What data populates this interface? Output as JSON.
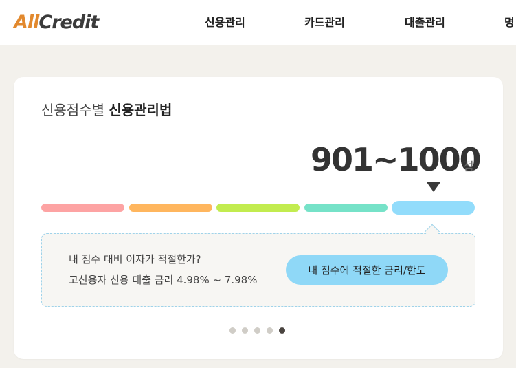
{
  "header": {
    "logo_part1": "All",
    "logo_part2": "Credit",
    "nav": [
      {
        "label": "신용관리"
      },
      {
        "label": "카드관리"
      },
      {
        "label": "대출관리"
      },
      {
        "label": "명"
      }
    ]
  },
  "card": {
    "title_regular": "신용점수별",
    "title_bold": "신용관리법",
    "score_range": "901~1000",
    "score_unit": "점",
    "grade_bars": [
      {
        "color": "#fda3a3"
      },
      {
        "color": "#ffb65e"
      },
      {
        "color": "#c2ec4f"
      },
      {
        "color": "#76e2c8"
      },
      {
        "color": "#92dcfb",
        "selected": true
      }
    ],
    "info": {
      "question": "내 점수 대비 이자가 적절한가?",
      "rate_text": "고신용자 신용 대출 금리 4.98% ~ 7.98%",
      "button_label": "내 점수에 적절한 금리/한도"
    },
    "pagination": {
      "total": 5,
      "current": 5
    }
  },
  "colors": {
    "logo_accent": "#e2892e",
    "background": "#f3f1ec",
    "button": "#8fd8f7",
    "dashed_border": "#9fd3ea"
  }
}
